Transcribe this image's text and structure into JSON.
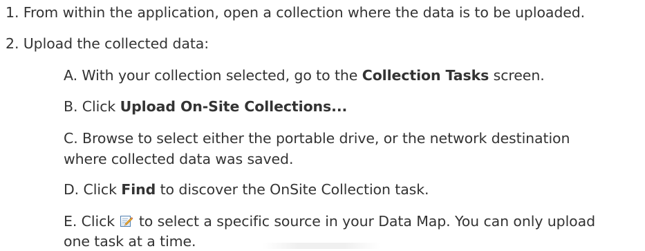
{
  "steps": [
    {
      "num": "1.",
      "text": "From within the application, open a collection where the data is to be uploaded."
    },
    {
      "num": "2.",
      "text": "Upload the collected data:"
    }
  ],
  "substeps": {
    "a": {
      "prefix": "A. With your collection selected, go to the ",
      "bold": "Collection Tasks",
      "suffix": " screen."
    },
    "b": {
      "prefix": "B. Click ",
      "bold": "Upload On-Site Collections..."
    },
    "c": {
      "line1": "C. Browse to select either the portable drive, or the network destination",
      "line2": "where collected data was saved."
    },
    "d": {
      "prefix": "D. Click ",
      "bold": "Find",
      "suffix": " to discover the OnSite Collection task."
    },
    "e": {
      "prefix": "E. Click ",
      "icon": "edit-pencil-icon",
      "suffix": " to select a specific source in your Data Map. You can only upload",
      "line2": "one task at a time."
    }
  }
}
